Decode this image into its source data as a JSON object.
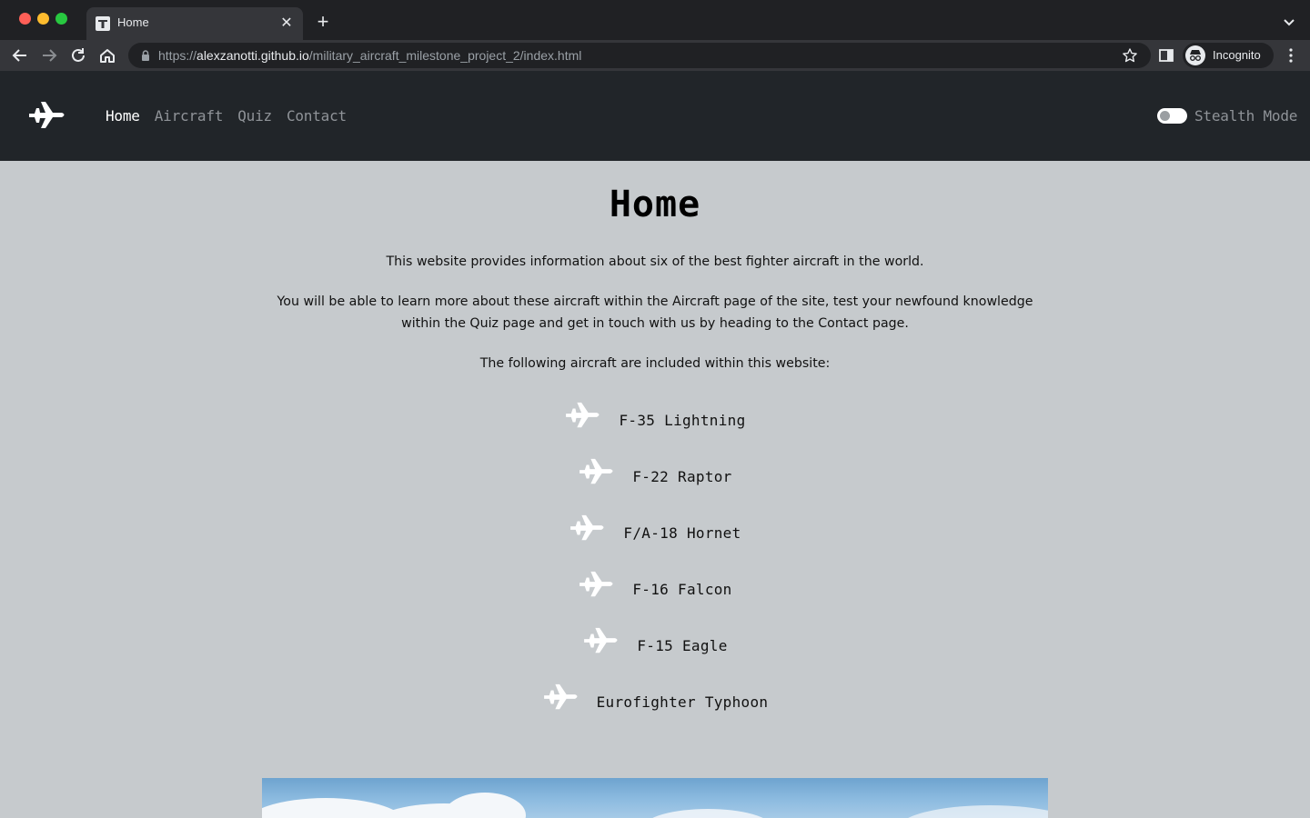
{
  "browser": {
    "tab_title": "Home",
    "url_scheme": "https://",
    "url_host": "alexzanotti.github.io",
    "url_path": "/military_aircraft_milestone_project_2/index.html",
    "profile_label": "Incognito"
  },
  "nav": {
    "links": [
      {
        "label": "Home",
        "active": true
      },
      {
        "label": "Aircraft",
        "active": false
      },
      {
        "label": "Quiz",
        "active": false
      },
      {
        "label": "Contact",
        "active": false
      }
    ],
    "stealth_label": "Stealth Mode",
    "stealth_on": false
  },
  "main": {
    "title": "Home",
    "intro": "This website provides information about six of the best fighter aircraft in the world.",
    "details": "You will be able to learn more about these aircraft within the Aircraft page of the site, test your newfound knowledge within the Quiz page and get in touch with us by heading to the Contact page.",
    "list_intro": "The following aircraft are included within this website:",
    "aircraft": [
      "F-35 Lightning",
      "F-22 Raptor",
      "F/A-18 Hornet",
      "F-16 Falcon",
      "F-15 Eagle",
      "Eurofighter Typhoon"
    ]
  },
  "colors": {
    "navbar": "#212529",
    "page_bg": "#c6cacd",
    "nav_active": "#ffffff",
    "nav_inactive": "#8f9398"
  },
  "icons": {
    "brand": "fighter-jet-icon",
    "list_item": "fighter-jet-icon"
  }
}
